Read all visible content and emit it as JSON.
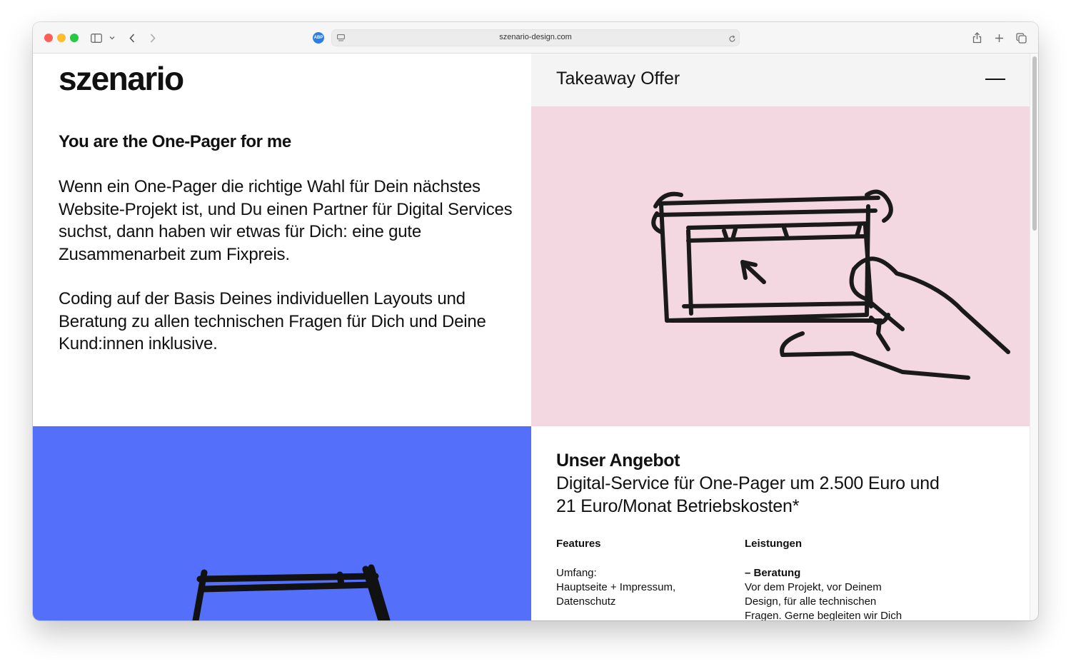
{
  "browser": {
    "url": "szenario-design.com",
    "adblock_label": "ABP"
  },
  "site": {
    "logo": "szenario",
    "heading": "You are the One-Pager for me",
    "paragraph1": "Wenn ein One-Pager die richtige Wahl für Dein nächstes Website-Projekt ist, und Du einen Partner für Digital Services suchst, dann haben wir etwas für Dich: eine gute Zusammenarbeit zum Fixpreis.",
    "paragraph2": "Coding auf der Basis Deines individuellen Layouts und Beratung zu allen technischen Fragen für Dich und Deine Kund:innen inklusive.",
    "panel_title": "Takeaway Offer",
    "offer": {
      "title": "Unser Angebot",
      "subtitle": "Digital-Service für One-Pager um 2.500 Euro und 21 Euro/Monat Betriebskosten*",
      "features_heading": "Features",
      "features_text": "Umfang:\nHauptseite + Impressum, Datenschutz",
      "services_heading": "Leistungen",
      "services_item_title": "– Beratung",
      "services_item_text": "Vor dem Projekt, vor Deinem Design, für alle technischen Fragen. Gerne begleiten wir Dich"
    }
  },
  "colors": {
    "blue_panel": "#5470fb",
    "pink_panel": "#f3d8e1",
    "header_gray": "#f4f4f4"
  }
}
